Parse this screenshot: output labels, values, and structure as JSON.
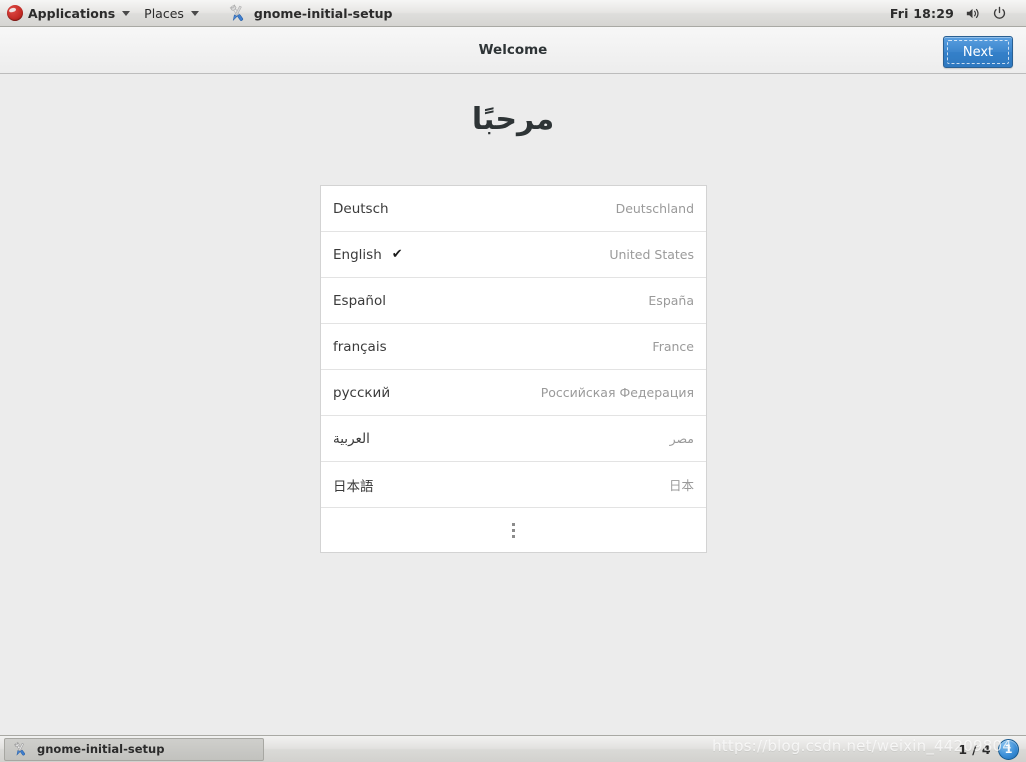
{
  "top_panel": {
    "applications_label": "Applications",
    "places_label": "Places",
    "window_title": "gnome-initial-setup",
    "clock": "Fri 18:29",
    "icons": {
      "menu_logo": "fedora-logo-icon",
      "window": "wrench-screwdriver-icon",
      "volume": "volume-icon",
      "power": "power-icon",
      "dropdown": "chevron-down-icon"
    }
  },
  "headerbar": {
    "title": "Welcome",
    "next_label": "Next"
  },
  "main": {
    "heading": "مرحبًا",
    "languages": [
      {
        "name": "Deutsch",
        "region": "Deutschland",
        "selected": false,
        "rtl": false
      },
      {
        "name": "English",
        "region": "United States",
        "selected": true,
        "rtl": false
      },
      {
        "name": "Español",
        "region": "España",
        "selected": false,
        "rtl": false
      },
      {
        "name": "français",
        "region": "France",
        "selected": false,
        "rtl": false
      },
      {
        "name": "русский",
        "region": "Российская Федерация",
        "selected": false,
        "rtl": false
      },
      {
        "name": "العربية",
        "region": "مصر",
        "selected": false,
        "rtl": true
      },
      {
        "name": "日本語",
        "region": "日本",
        "selected": false,
        "rtl": false
      }
    ],
    "checkmark": "✔",
    "more_icon": "more-vertical-icon"
  },
  "bottom_panel": {
    "task_label": "gnome-initial-setup",
    "workspace_indicator": "1 / 4",
    "workspace_badge": "1"
  },
  "watermark": "https://blog.csdn.net/weixin_44209804",
  "colors": {
    "accent_blue": "#3480c9",
    "panel_gray": "#dededc",
    "content_bg": "#ececec",
    "list_bg": "#ffffff",
    "muted_text": "#9a9a9a"
  }
}
